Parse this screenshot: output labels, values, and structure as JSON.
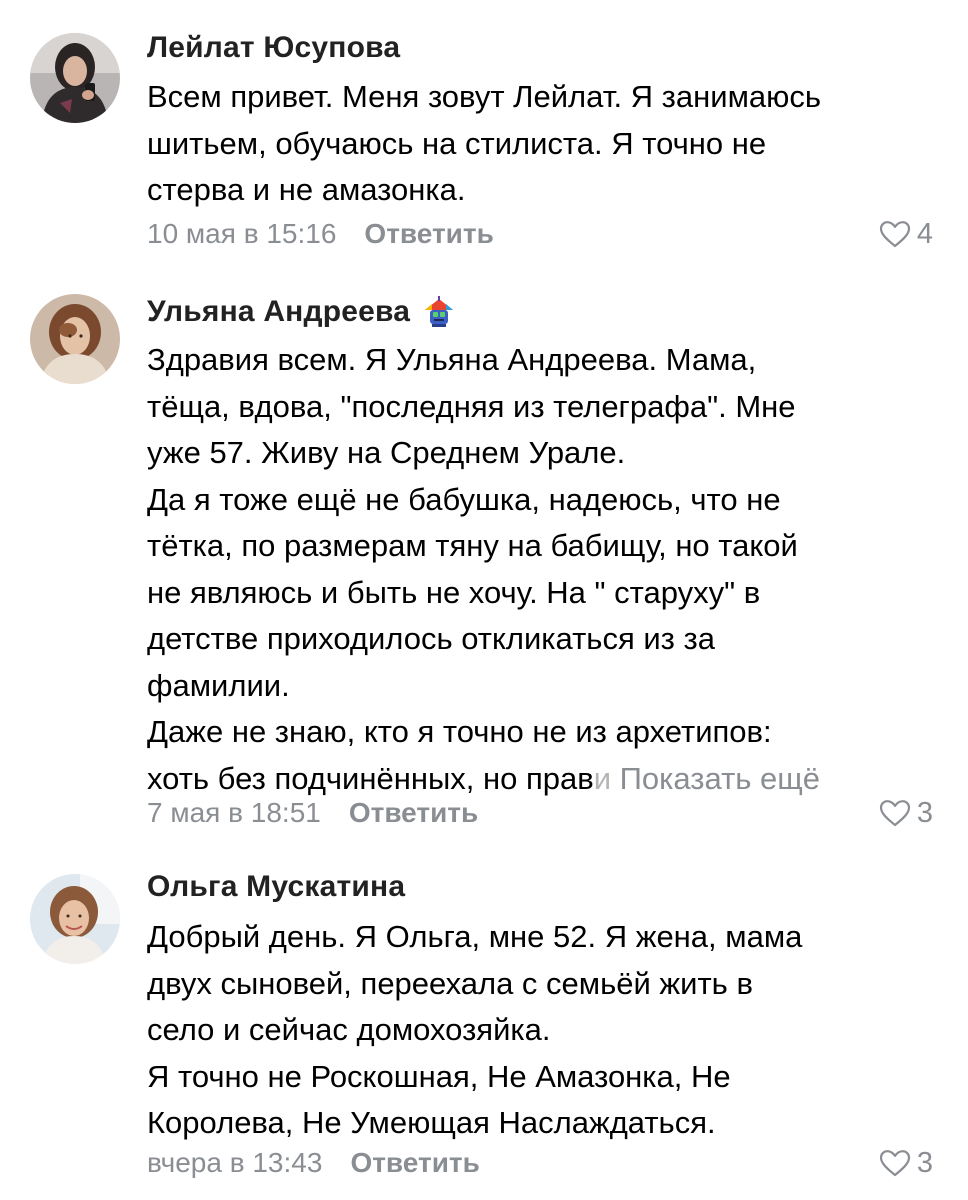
{
  "comments": [
    {
      "author": "Лейлат Юсупова",
      "lines": [
        "Всем привет. Меня зовут Лейлат. Я занимаюсь",
        "шитьем, обучаюсь на стилиста. Я точно не",
        "стерва и не амазонка."
      ],
      "time": "10 мая в 15:16",
      "reply_label": "Ответить",
      "likes": "4",
      "avatar_icon": "user-photo-icon"
    },
    {
      "author": "Ульяна Андреева",
      "author_badge_icon": "badge-icon",
      "lines": [
        "Здравия всем. Я Ульяна Андреева. Мама,",
        "тёща, вдова, \"последняя из телеграфа\". Мне",
        "уже 57. Живу на Среднем Урале.",
        "Да я тоже ещё не бабушка, надеюсь, что не",
        "тётка, по размерам тяну на бабищу, но такой",
        "не являюсь и быть не хочу. На \" старуху\" в",
        "детстве приходилось откликаться из за",
        "фамилии.",
        "Даже не знаю, кто я точно не из архетипов:"
      ],
      "last_line_start": "хоть без подчинённых, но прав",
      "last_line_faded": "и",
      "show_more_label": "Показать ещё",
      "time": "7 мая в 18:51",
      "reply_label": "Ответить",
      "likes": "3",
      "avatar_icon": "user-photo-icon"
    },
    {
      "author": "Ольга Мускатина",
      "lines": [
        "Добрый день. Я Ольга, мне 52. Я жена, мама",
        "двух сыновей, переехала с семьёй жить в",
        "село и сейчас домохозяйка.",
        "Я точно не Роскошная, Не Амазонка, Не",
        "Королева, Не Умеющая Наслаждаться."
      ],
      "time": "вчера в 13:43",
      "reply_label": "Ответить",
      "likes": "3",
      "avatar_icon": "user-photo-icon"
    }
  ],
  "icons": {
    "like": "heart-outline-icon"
  },
  "colors": {
    "text": "#000000",
    "author": "#222222",
    "muted": "#8a8e93",
    "background": "#ffffff"
  }
}
